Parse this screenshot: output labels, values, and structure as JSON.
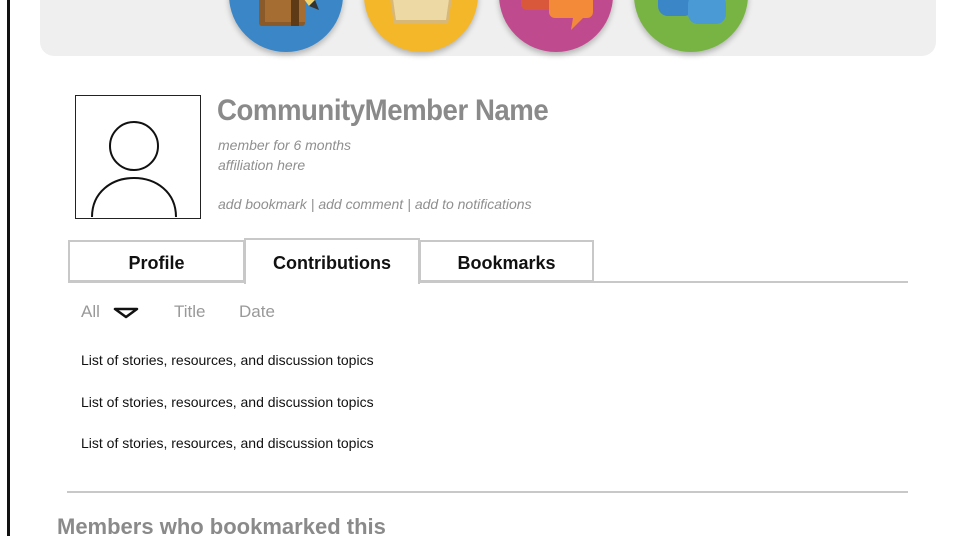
{
  "nav": {
    "icons": [
      {
        "name": "notebook-icon",
        "color": "#3b86c6"
      },
      {
        "name": "folder-icon",
        "color": "#f5b72a"
      },
      {
        "name": "chat-bubbles-icon",
        "color": "#c04a8e"
      },
      {
        "name": "people-icon",
        "color": "#78b443"
      }
    ]
  },
  "profile": {
    "name": "CommunityMember Name",
    "membership": "member for 6 months",
    "affiliation": "affiliation here",
    "avatar_icon": "user-silhouette-icon",
    "actions": {
      "bookmark": "add bookmark",
      "comment": "add comment",
      "notifications": "add to notifications",
      "separator": "|"
    }
  },
  "tabs": [
    {
      "label": "Profile"
    },
    {
      "label": "Contributions",
      "active": true
    },
    {
      "label": "Bookmarks"
    }
  ],
  "filters": {
    "all": "All",
    "title": "Title",
    "date": "Date"
  },
  "list": [
    "List of stories, resources, and discussion topics",
    "List of stories, resources, and discussion topics",
    "List of stories, resources, and discussion topics"
  ],
  "section": {
    "heading": "Members who bookmarked this"
  }
}
